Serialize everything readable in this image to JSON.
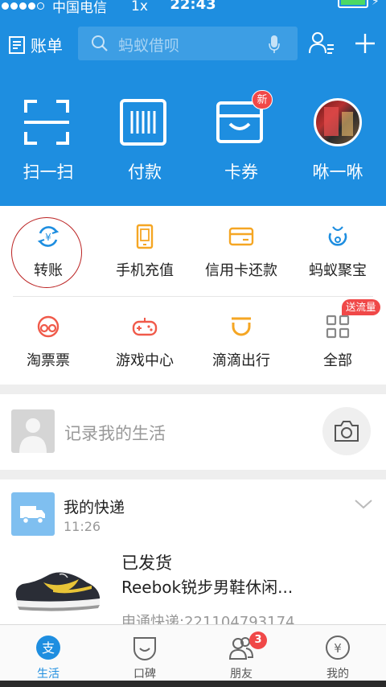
{
  "status_bar": {
    "carrier": "中国电信",
    "speed": "1x",
    "time": "22:43",
    "battery_fraction": 1.0
  },
  "navbar": {
    "bill_label": "账单",
    "search_placeholder": "蚂蚁借呗",
    "icons": [
      "bill-icon",
      "search-icon",
      "mic-icon",
      "contacts-icon",
      "plus-icon"
    ]
  },
  "quick_actions": [
    {
      "label": "扫一扫",
      "icon": "scan-icon"
    },
    {
      "label": "付款",
      "icon": "barcode-icon"
    },
    {
      "label": "卡券",
      "icon": "wallet-icon",
      "badge": "新"
    },
    {
      "label": "咻一咻",
      "icon": "avatar-photo"
    }
  ],
  "services": [
    {
      "label": "转账",
      "icon": "transfer-icon",
      "color": "#1e8ee0"
    },
    {
      "label": "手机充值",
      "icon": "phone-icon",
      "color": "#f5a623"
    },
    {
      "label": "信用卡还款",
      "icon": "credit-card-icon",
      "color": "#f5a623"
    },
    {
      "label": "蚂蚁聚宝",
      "icon": "ant-fortune-icon",
      "color": "#1e8ee0"
    },
    {
      "label": "淘票票",
      "icon": "glasses-icon",
      "color": "#f05a4a"
    },
    {
      "label": "游戏中心",
      "icon": "gamepad-icon",
      "color": "#f05a4a"
    },
    {
      "label": "滴滴出行",
      "icon": "didi-icon",
      "color": "#f5a623"
    },
    {
      "label": "全部",
      "icon": "grid-icon",
      "color": "#888888",
      "badge": "送流量"
    }
  ],
  "life": {
    "prompt": "记录我的生活"
  },
  "express": {
    "title": "我的快递",
    "time": "11:26",
    "status": "已发货",
    "product": "Reebok锐步男鞋休闲...",
    "tracking": "申通快递:221104793174"
  },
  "tabbar": [
    {
      "label": "生活",
      "icon": "life-icon",
      "active": true
    },
    {
      "label": "口碑",
      "icon": "koubei-icon",
      "active": false
    },
    {
      "label": "朋友",
      "icon": "friends-icon",
      "active": false,
      "badge": "3"
    },
    {
      "label": "我的",
      "icon": "yuan-icon",
      "active": false
    }
  ],
  "colors": {
    "header_blue": "#1e8ee0",
    "badge_red": "#f04848",
    "orange": "#f5a623",
    "red_icon": "#f05a4a"
  }
}
